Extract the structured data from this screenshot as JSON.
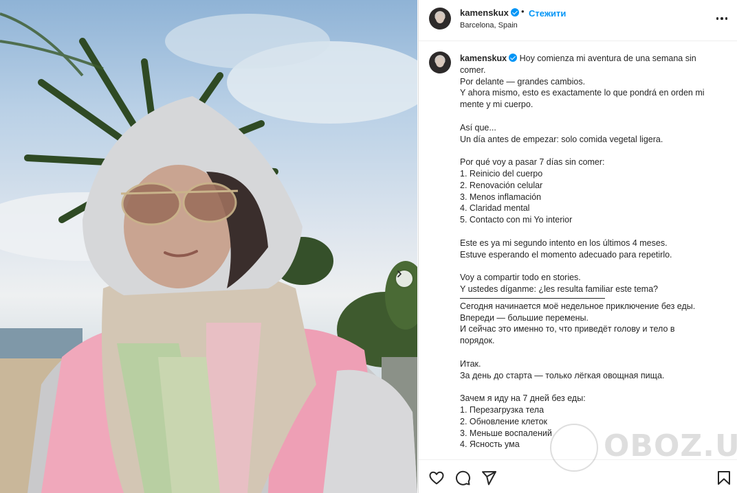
{
  "header": {
    "username": "kamenskux",
    "separator": "•",
    "follow_label": "Стежити",
    "location": "Barcelona, Spain",
    "more_icon": "more-horizontal-icon"
  },
  "caption": {
    "username": "kamenskux",
    "lines": [
      "Hoy comienza mi aventura de una semana sin",
      "comer.",
      "Por delante — grandes cambios.",
      "Y ahora mismo, esto es exactamente lo que pondrá en orden mi",
      "mente y mi cuerpo.",
      "",
      "Así que...",
      "Un día antes de empezar: solo comida vegetal ligera.",
      "",
      "Por qué voy a pasar 7 días sin comer:",
      "1. Reinicio del cuerpo",
      "2. Renovación celular",
      "3. Menos inflamación",
      "4. Claridad mental",
      "5. Contacto con mi Yo interior",
      "",
      "Este es ya mi segundo intento en los últimos 4 meses.",
      "Estuve esperando el momento adecuado para repetirlo.",
      "",
      "Voy a compartir todo en stories.",
      "Y ustedes díganme: ¿les resulta familiar este tema?"
    ],
    "lines_ru": [
      "Сегодня начинается моё недельное приключение без еды.",
      "Впереди — большие перемены.",
      "И сейчас это именно то, что приведёт голову и тело в",
      "порядок.",
      "",
      "Итак.",
      "За день до старта — только лёгкая овощная пища.",
      "",
      "Зачем я иду на 7 дней без еды:",
      "1. Перезагрузка тела",
      "2. Обновление клеток",
      "3. Меньше воспалений",
      "4. Ясность ума"
    ]
  },
  "watermark": {
    "text": "OBOZ.UA"
  },
  "actions": {
    "like_icon": "heart-icon",
    "comment_icon": "comment-icon",
    "share_icon": "send-icon",
    "save_icon": "bookmark-icon"
  },
  "photo": {
    "next_icon": "chevron-right-icon"
  },
  "colors": {
    "accent": "#0095f6",
    "text": "#262626",
    "border": "#dbdbdb"
  }
}
